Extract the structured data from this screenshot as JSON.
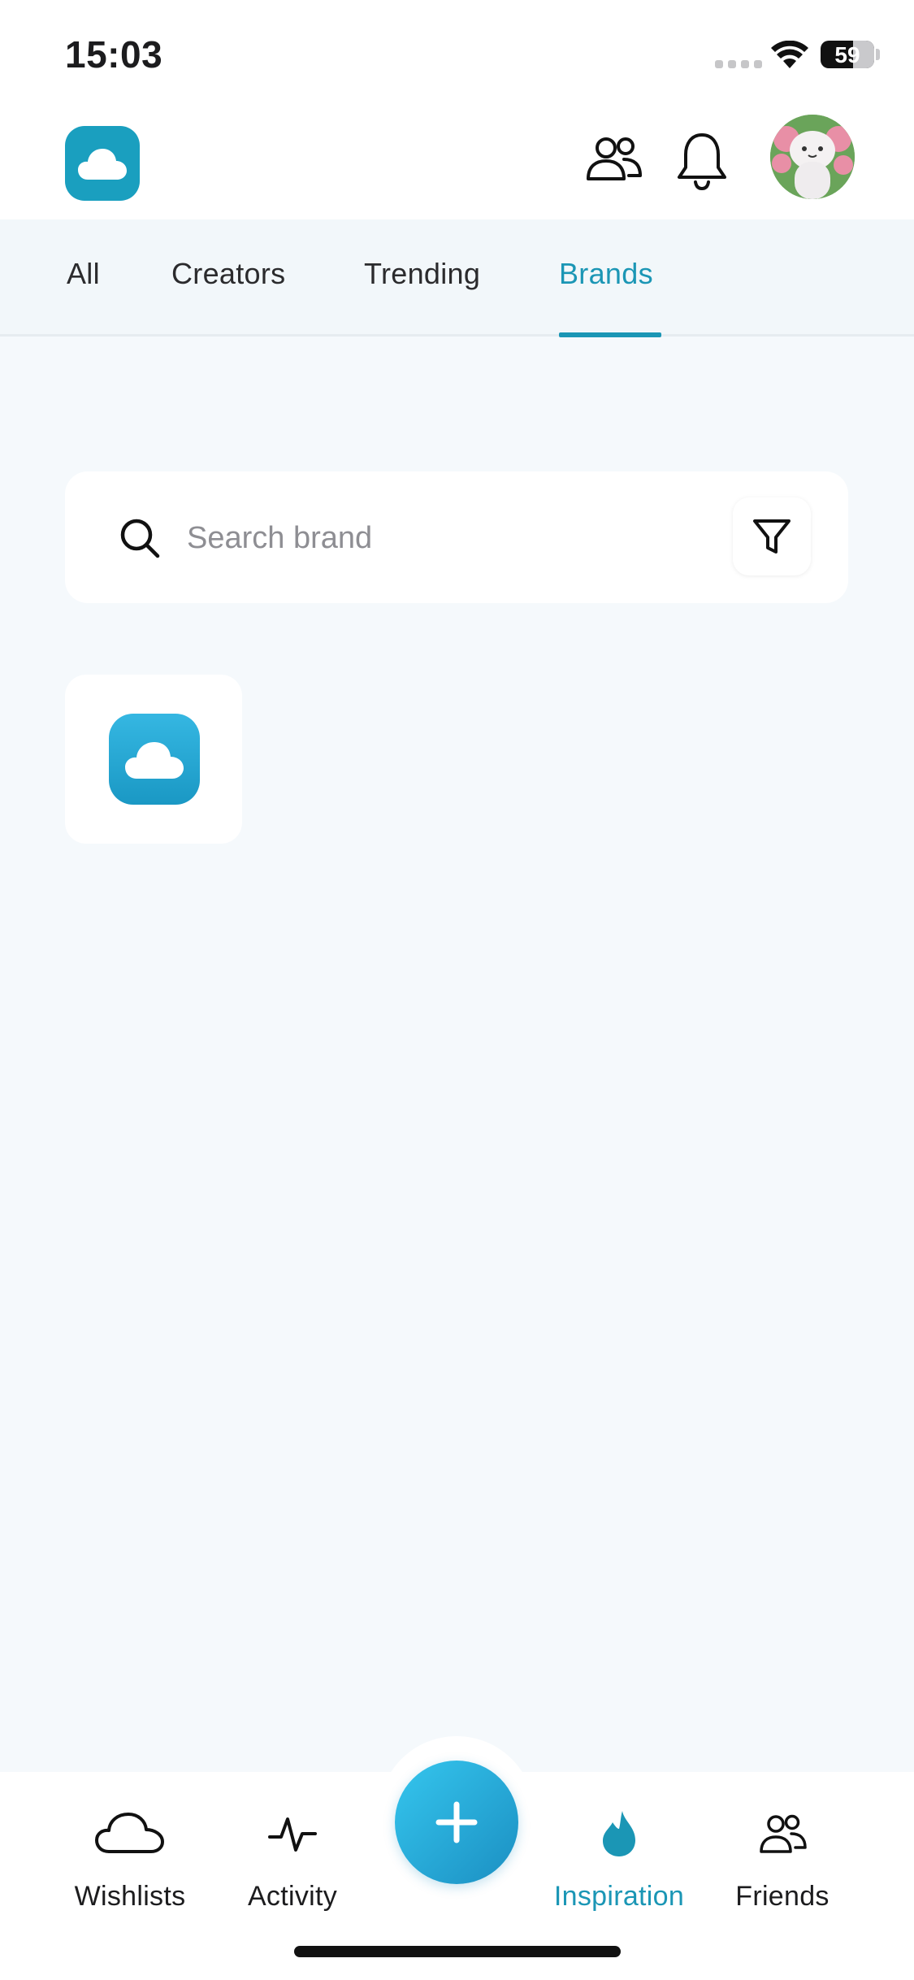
{
  "status_bar": {
    "time": "15:03",
    "battery_level": "59"
  },
  "header": {
    "logo_icon": "cloud-icon",
    "actions": [
      "people-icon",
      "bell-icon"
    ],
    "avatar": "avatar"
  },
  "tabs": {
    "items": [
      {
        "label": "All",
        "active": false
      },
      {
        "label": "Creators",
        "active": false
      },
      {
        "label": "Trending",
        "active": false
      },
      {
        "label": "Brands",
        "active": true
      }
    ]
  },
  "search": {
    "placeholder": "Search brand",
    "value": "",
    "filter_icon": "filter-icon"
  },
  "brands": {
    "items": [
      {
        "logo_icon": "cloud-icon"
      }
    ]
  },
  "bottom_nav": {
    "items": [
      {
        "label": "Wishlists",
        "icon": "cloud-outline-icon",
        "active": false
      },
      {
        "label": "Activity",
        "icon": "activity-icon",
        "active": false
      },
      {
        "label": "Inspiration",
        "icon": "flame-icon",
        "active": true
      },
      {
        "label": "Friends",
        "icon": "friends-icon",
        "active": false
      }
    ],
    "add_icon": "plus-icon"
  },
  "colors": {
    "accent": "#1b96b5",
    "background": "#f5f9fc",
    "surface": "#ffffff"
  }
}
